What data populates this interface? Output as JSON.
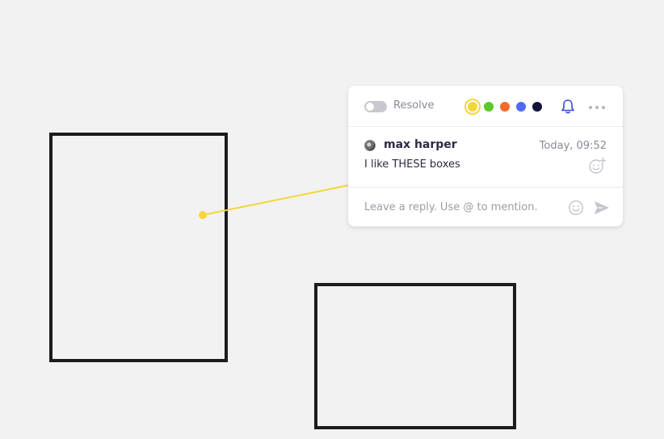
{
  "comment_card": {
    "resolve_label": "Resolve",
    "resolved": false,
    "colors": [
      {
        "name": "yellow",
        "hex": "#f5d63b",
        "selected": true
      },
      {
        "name": "green",
        "hex": "#5ac82a",
        "selected": false
      },
      {
        "name": "orange",
        "hex": "#f26b2e",
        "selected": false
      },
      {
        "name": "blue",
        "hex": "#4f6bf2",
        "selected": false
      },
      {
        "name": "navy",
        "hex": "#14133a",
        "selected": false
      }
    ],
    "comment": {
      "author": "max harper",
      "timestamp": "Today, 09:52",
      "text": "I like THESE boxes"
    },
    "reply": {
      "placeholder": "Leave a reply. Use @ to mention.",
      "value": ""
    }
  },
  "theme": {
    "accent": "#3b4bd8",
    "connector": "#f5d63b",
    "canvas_bg": "#f2f2f2",
    "shape_stroke": "#1c1c1c"
  },
  "icons": {
    "notification": "bell-icon",
    "more": "more-options-icon",
    "add_reaction": "add-reaction-icon",
    "emoji": "emoji-icon",
    "send": "send-icon"
  }
}
